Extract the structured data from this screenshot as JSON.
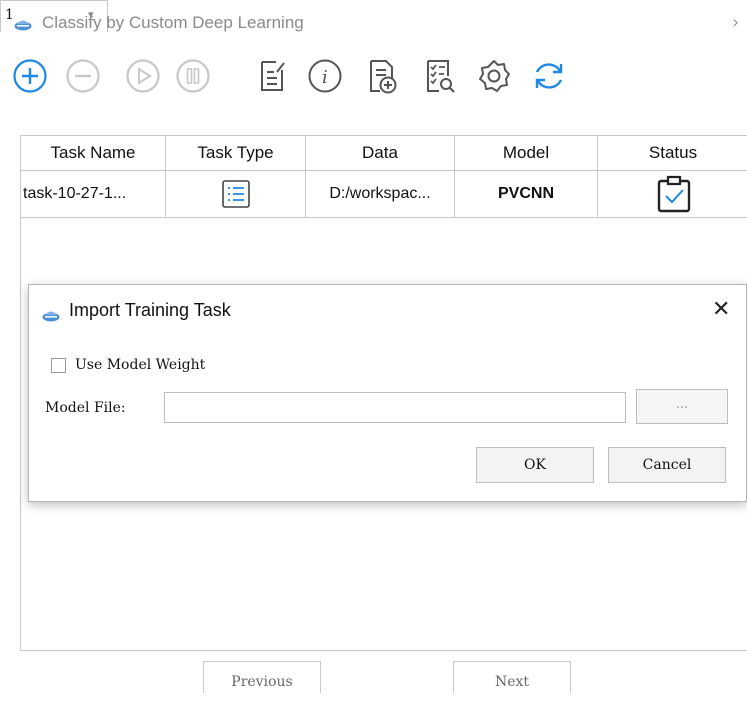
{
  "window": {
    "title": "Classify by Custom Deep Learning",
    "close_glyph": "›"
  },
  "toolbar": {
    "buttons": [
      {
        "name": "add-icon",
        "color": "#1e88e5"
      },
      {
        "name": "remove-icon",
        "color": "#c8c8c8"
      },
      {
        "name": "start-icon",
        "color": "#c8c8c8"
      },
      {
        "name": "pause-icon",
        "color": "#c8c8c8"
      },
      {
        "name": "edit-document-icon",
        "color": "#555555"
      },
      {
        "name": "info-icon",
        "color": "#555555"
      },
      {
        "name": "import-document-icon",
        "color": "#555555"
      },
      {
        "name": "view-report-icon",
        "color": "#555555"
      },
      {
        "name": "settings-icon",
        "color": "#555555"
      },
      {
        "name": "refresh-icon",
        "color": "#1e88e5"
      }
    ]
  },
  "table": {
    "columns": [
      "Task Name",
      "Task Type",
      "Data",
      "Model",
      "Status"
    ],
    "rows": [
      {
        "task_name": "task-10-27-1...",
        "task_type_icon": "list-icon",
        "data": "D:/workspac...",
        "model": "PVCNN",
        "status_icon": "clipboard-check-icon"
      }
    ]
  },
  "dialog": {
    "title": "Import Training Task",
    "close_glyph": "✕",
    "use_model_weight": {
      "label": "Use Model Weight",
      "checked": false
    },
    "model_file": {
      "label": "Model File:",
      "value": ""
    },
    "browse_label": "...",
    "ok_label": "OK",
    "cancel_label": "Cancel"
  },
  "pagination": {
    "previous_label": "Previous",
    "page_value": "1",
    "dropdown_glyph": "▾",
    "next_label": "Next"
  }
}
